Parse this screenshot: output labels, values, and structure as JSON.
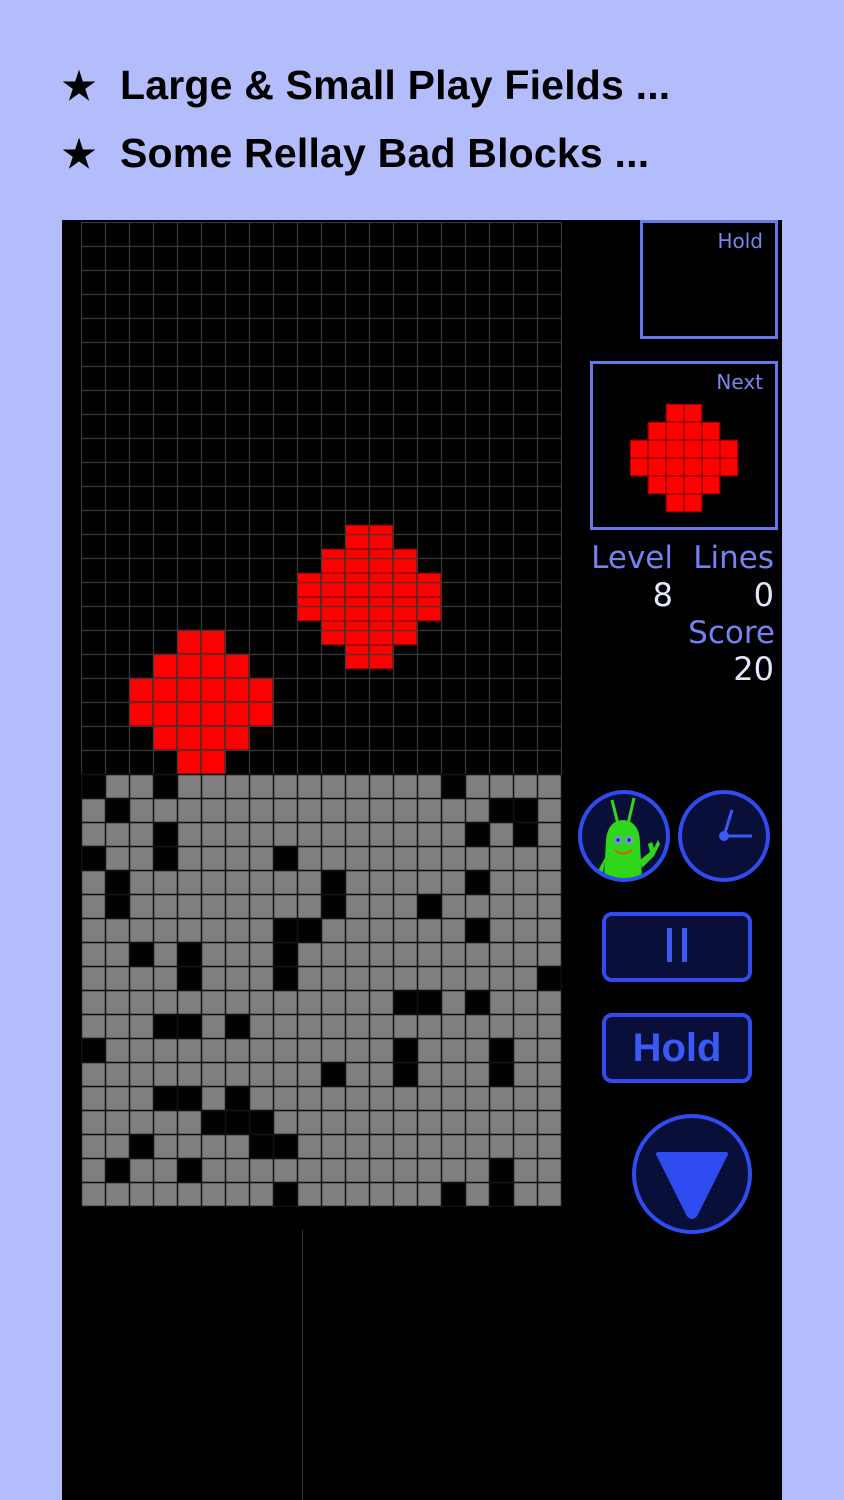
{
  "features": [
    {
      "icon": "★",
      "text": "Large & Small Play Fields ..."
    },
    {
      "icon": "★",
      "text": "Some Rellay Bad Blocks ..."
    }
  ],
  "colors": {
    "background": "#b3bdfc",
    "panel": "#000000",
    "grid_line": "#3a3a3a",
    "garbage_block": "#7f7e80",
    "piece": "#ff0000",
    "accent": "#2f4cf0",
    "box_border": "#6677ea",
    "label": "#7482f2",
    "value": "#e4e6ff"
  },
  "board": {
    "columns": 20,
    "rows": 41,
    "garbage_top_row": 23,
    "garbage_holes": [
      [
        23,
        [
          0,
          3,
          15
        ]
      ],
      [
        24,
        [
          1,
          17,
          18
        ]
      ],
      [
        25,
        [
          3,
          16,
          18
        ]
      ],
      [
        26,
        [
          0,
          3,
          8
        ]
      ],
      [
        27,
        [
          1,
          10,
          16
        ]
      ],
      [
        28,
        [
          1,
          10,
          14
        ]
      ],
      [
        29,
        [
          8,
          9,
          16
        ]
      ],
      [
        30,
        [
          2,
          4,
          8
        ]
      ],
      [
        31,
        [
          4,
          8,
          19
        ]
      ],
      [
        32,
        [
          13,
          14,
          16
        ]
      ],
      [
        33,
        [
          3,
          4,
          6
        ]
      ],
      [
        34,
        [
          0,
          13,
          17
        ]
      ],
      [
        35,
        [
          10,
          13,
          17
        ]
      ],
      [
        36,
        [
          3,
          4,
          6
        ]
      ],
      [
        37,
        [
          5,
          6,
          7
        ]
      ],
      [
        38,
        [
          2,
          7,
          8
        ]
      ],
      [
        39,
        [
          1,
          4,
          17
        ]
      ],
      [
        40,
        [
          8,
          15,
          17
        ]
      ]
    ],
    "pieces": [
      {
        "name": "landed-diamond",
        "row": 17,
        "col": 2
      },
      {
        "name": "falling-diamond",
        "row": 12.625,
        "col": 9
      }
    ]
  },
  "piece_shape": [
    [
      0,
      0,
      1,
      1,
      0,
      0
    ],
    [
      0,
      1,
      1,
      1,
      1,
      0
    ],
    [
      1,
      1,
      1,
      1,
      1,
      1
    ],
    [
      1,
      1,
      1,
      1,
      1,
      1
    ],
    [
      0,
      1,
      1,
      1,
      1,
      0
    ],
    [
      0,
      0,
      1,
      1,
      0,
      0
    ]
  ],
  "hold": {
    "label": "Hold",
    "piece": null
  },
  "next": {
    "label": "Next",
    "piece": "diamond"
  },
  "stats": {
    "level_label": "Level",
    "level": "8",
    "lines_label": "Lines",
    "lines": "0",
    "score_label": "Score",
    "score": "20"
  },
  "controls": {
    "mascot": "green-alien-mascot",
    "clock": "clock-icon",
    "pause": "pause-icon",
    "hold_label": "Hold",
    "drop": "down-triangle-icon"
  }
}
